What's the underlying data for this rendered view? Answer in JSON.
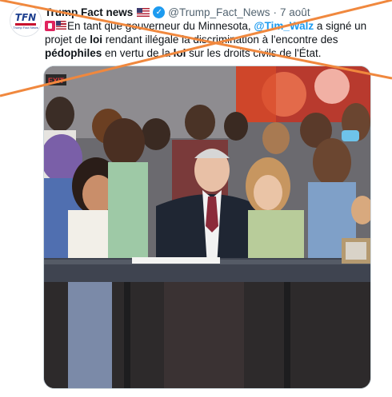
{
  "tweet": {
    "avatar_text": "TFN",
    "avatar_subtext": "Trump Fact News",
    "author_name": "Trump Fact news",
    "handle": "@Trump_Fact_News",
    "separator": "·",
    "date": "7 août",
    "text": {
      "p1": "En tant que gouverneur du Minnesota, ",
      "mention": "@Tim_Walz",
      "p2": " a signé un projet de ",
      "loi1": "loi",
      "p3": " rendant illégale la discrimination à l'encontre des ",
      "pedophiles": "pédophiles",
      "p4": " en vertu de la ",
      "loi2": "loi",
      "p5": " sur les droits civils de l'État."
    }
  },
  "photo": {
    "sign_text": "EXIT"
  },
  "colors": {
    "accent": "#1d9bf0",
    "cross": "#f0883e",
    "text": "#0f1419",
    "muted": "#536471"
  },
  "icons": [
    "tfn-logo-avatar",
    "us-flag-icon",
    "verified-badge-icon",
    "red-label-icon",
    "us-flag-emoji-icon"
  ]
}
